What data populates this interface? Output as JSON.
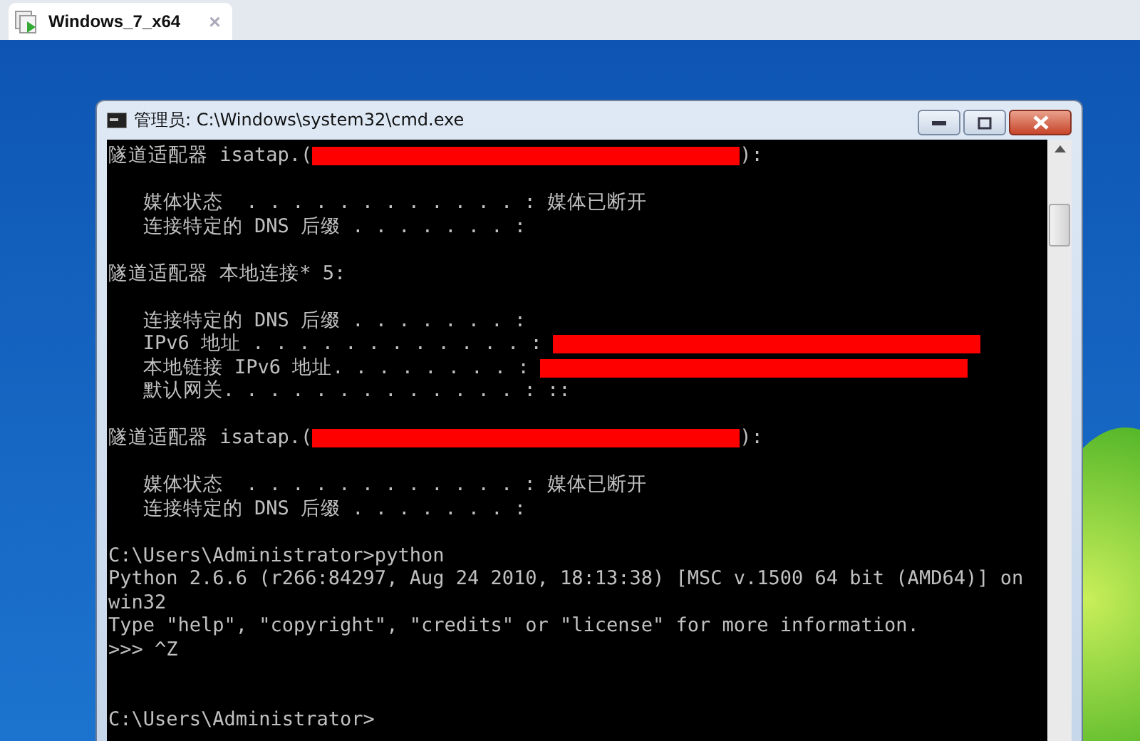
{
  "browser_tab": {
    "label": "Windows_7_x64",
    "selected": true,
    "close": "×"
  },
  "cmd_window": {
    "title": "管理员: C:\\Windows\\system32\\cmd.exe",
    "console": {
      "lines": [
        {
          "segments": [
            {
              "kind": "text",
              "text": "隧道适配器 isatap.("
            },
            {
              "kind": "redaction"
            },
            {
              "kind": "text",
              "text": "):"
            }
          ]
        },
        {
          "segments": [
            {
              "kind": "blank"
            }
          ]
        },
        {
          "segments": [
            {
              "kind": "text",
              "text": "   媒体状态  . . . . . . . . . . . . : 媒体已断开"
            }
          ]
        },
        {
          "segments": [
            {
              "kind": "text",
              "text": "   连接特定的 DNS 后缀 . . . . . . . :"
            }
          ]
        },
        {
          "segments": [
            {
              "kind": "blank"
            }
          ]
        },
        {
          "segments": [
            {
              "kind": "text",
              "text": "隧道适配器 本地连接* 5:"
            }
          ]
        },
        {
          "segments": [
            {
              "kind": "blank"
            }
          ]
        },
        {
          "segments": [
            {
              "kind": "text",
              "text": "   连接特定的 DNS 后缀 . . . . . . . :"
            }
          ]
        },
        {
          "segments": [
            {
              "kind": "text",
              "text": "   IPv6 地址 . . . . . . . . . . . . : "
            },
            {
              "kind": "redaction"
            }
          ]
        },
        {
          "segments": [
            {
              "kind": "text",
              "text": "   本地链接 IPv6 地址. . . . . . . . : "
            },
            {
              "kind": "redaction"
            }
          ]
        },
        {
          "segments": [
            {
              "kind": "text",
              "text": "   默认网关. . . . . . . . . . . . . : ::"
            }
          ]
        },
        {
          "segments": [
            {
              "kind": "blank"
            }
          ]
        },
        {
          "segments": [
            {
              "kind": "text",
              "text": "隧道适配器 isatap.("
            },
            {
              "kind": "redaction"
            },
            {
              "kind": "text",
              "text": "):"
            }
          ]
        },
        {
          "segments": [
            {
              "kind": "blank"
            }
          ]
        },
        {
          "segments": [
            {
              "kind": "text",
              "text": "   媒体状态  . . . . . . . . . . . . : 媒体已断开"
            }
          ]
        },
        {
          "segments": [
            {
              "kind": "text",
              "text": "   连接特定的 DNS 后缀 . . . . . . . :"
            }
          ]
        },
        {
          "segments": [
            {
              "kind": "blank"
            }
          ]
        },
        {
          "segments": [
            {
              "kind": "text",
              "text": "C:\\Users\\Administrator>python"
            }
          ]
        },
        {
          "segments": [
            {
              "kind": "text",
              "text": "Python 2.6.6 (r266:84297, Aug 24 2010, 18:13:38) [MSC v.1500 64 bit (AMD64)] on"
            }
          ]
        },
        {
          "segments": [
            {
              "kind": "text",
              "text": "win32"
            }
          ]
        },
        {
          "segments": [
            {
              "kind": "text",
              "text": "Type \"help\", \"copyright\", \"credits\" or \"license\" for more information."
            }
          ]
        },
        {
          "segments": [
            {
              "kind": "text",
              "text": ">>> ^Z"
            }
          ]
        },
        {
          "segments": [
            {
              "kind": "blank"
            }
          ]
        },
        {
          "segments": [
            {
              "kind": "blank"
            }
          ]
        },
        {
          "segments": [
            {
              "kind": "text",
              "text": "C:\\Users\\Administrator>"
            }
          ]
        }
      ]
    }
  }
}
